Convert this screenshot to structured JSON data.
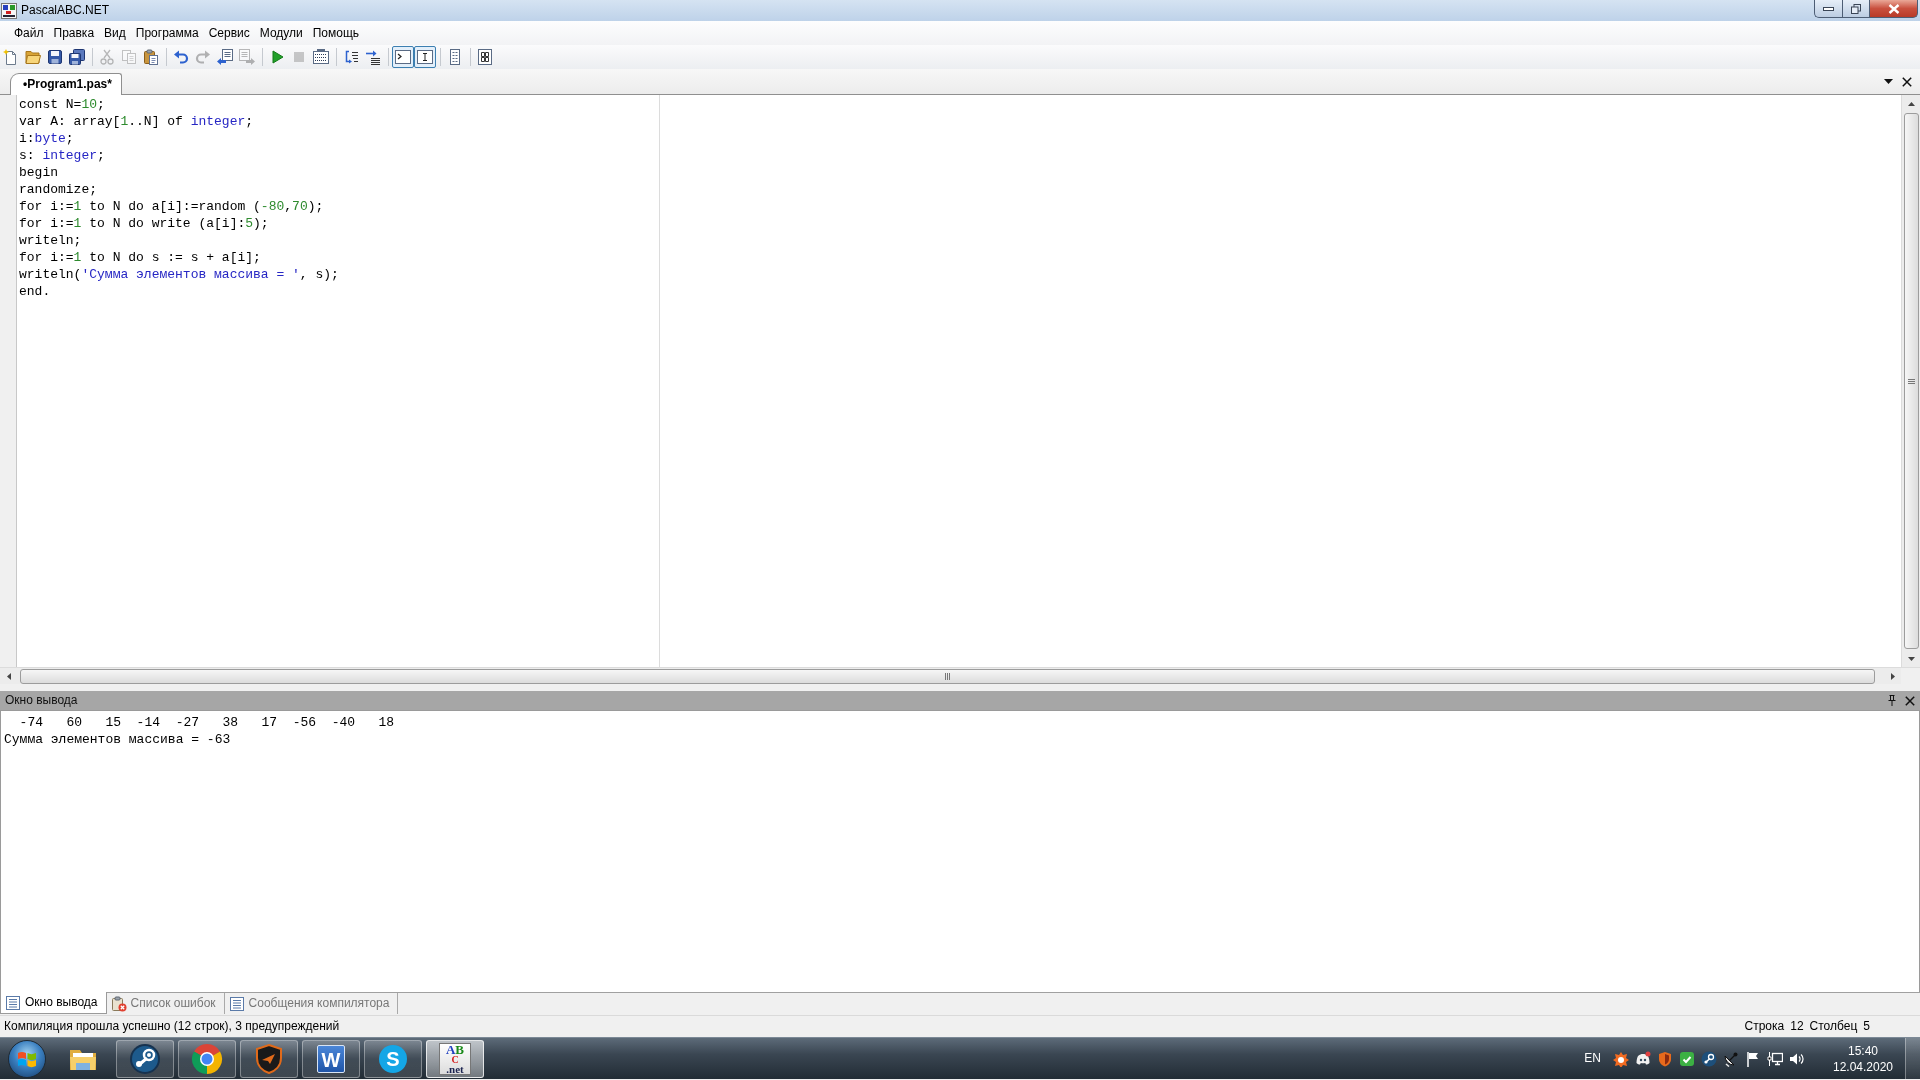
{
  "window": {
    "title": "PascalABC.NET"
  },
  "menu": [
    "Файл",
    "Правка",
    "Вид",
    "Программа",
    "Сервис",
    "Модули",
    "Помощь"
  ],
  "toolbar": [
    {
      "buttons": [
        {
          "disabled": false,
          "pressed": false
        },
        {
          "disabled": false,
          "pressed": false
        },
        {
          "disabled": false,
          "pressed": false
        },
        {
          "disabled": false,
          "pressed": false
        }
      ]
    },
    {
      "buttons": [
        {
          "disabled": true,
          "pressed": false
        },
        {
          "disabled": true,
          "pressed": false
        },
        {
          "disabled": false,
          "pressed": false
        }
      ]
    },
    {
      "buttons": [
        {
          "disabled": false,
          "pressed": false
        },
        {
          "disabled": true,
          "pressed": false
        },
        {
          "disabled": false,
          "pressed": false
        },
        {
          "disabled": true,
          "pressed": false
        }
      ]
    },
    {
      "buttons": [
        {
          "disabled": false,
          "pressed": false
        },
        {
          "disabled": true,
          "pressed": false
        },
        {
          "disabled": false,
          "pressed": false
        }
      ]
    },
    {
      "buttons": [
        {
          "disabled": false,
          "pressed": false
        },
        {
          "disabled": false,
          "pressed": false
        }
      ]
    },
    {
      "buttons": [
        {
          "disabled": false,
          "pressed": true
        },
        {
          "disabled": false,
          "pressed": true
        }
      ]
    },
    {
      "buttons": [
        {
          "disabled": false,
          "pressed": false
        }
      ]
    },
    {
      "buttons": [
        {
          "disabled": false,
          "pressed": false
        }
      ]
    }
  ],
  "editor_tabs": [
    {
      "label": "•Program1.pas*",
      "selected": true
    }
  ],
  "editor": {
    "lines": [
      [
        {
          "text": "const N=",
          "kind": "plain"
        },
        {
          "text": "10",
          "kind": "number"
        },
        {
          "text": ";",
          "kind": "plain"
        }
      ],
      [
        {
          "text": "var A: array[",
          "kind": "plain"
        },
        {
          "text": "1",
          "kind": "number"
        },
        {
          "text": "..N] of ",
          "kind": "plain"
        },
        {
          "text": "integer",
          "kind": "type"
        },
        {
          "text": ";",
          "kind": "plain"
        }
      ],
      [
        {
          "text": "i:",
          "kind": "plain"
        },
        {
          "text": "byte",
          "kind": "type"
        },
        {
          "text": ";",
          "kind": "plain"
        }
      ],
      [
        {
          "text": "s: ",
          "kind": "plain"
        },
        {
          "text": "integer",
          "kind": "type"
        },
        {
          "text": ";",
          "kind": "plain"
        }
      ],
      [
        {
          "text": "begin",
          "kind": "plain"
        }
      ],
      [
        {
          "text": "randomize;",
          "kind": "plain"
        }
      ],
      [
        {
          "text": "for i:=",
          "kind": "plain"
        },
        {
          "text": "1",
          "kind": "number"
        },
        {
          "text": " to N do a[i]:=random (",
          "kind": "plain"
        },
        {
          "text": "-80",
          "kind": "number"
        },
        {
          "text": ",",
          "kind": "plain"
        },
        {
          "text": "70",
          "kind": "number"
        },
        {
          "text": ");",
          "kind": "plain"
        }
      ],
      [
        {
          "text": "for i:=",
          "kind": "plain"
        },
        {
          "text": "1",
          "kind": "number"
        },
        {
          "text": " to N do write (a[i]:",
          "kind": "plain"
        },
        {
          "text": "5",
          "kind": "number"
        },
        {
          "text": ");",
          "kind": "plain"
        }
      ],
      [
        {
          "text": "writeln;",
          "kind": "plain"
        }
      ],
      [
        {
          "text": "for i:=",
          "kind": "plain"
        },
        {
          "text": "1",
          "kind": "number"
        },
        {
          "text": " to N do s := s + a[i];",
          "kind": "plain"
        }
      ],
      [
        {
          "text": "writeln(",
          "kind": "plain"
        },
        {
          "text": "'Сумма элементов массива = '",
          "kind": "string"
        },
        {
          "text": ", s);",
          "kind": "plain"
        }
      ],
      [
        {
          "text": "end.",
          "kind": "plain"
        }
      ]
    ]
  },
  "output_panel": {
    "title": "Окно вывода",
    "lines": [
      "  -74   60   15  -14  -27   38   17  -56  -40   18",
      "Сумма элементов массива = -63"
    ]
  },
  "bottom_tabs": [
    {
      "label": "Окно вывода",
      "selected": true
    },
    {
      "label": "Список ошибок",
      "selected": false
    },
    {
      "label": "Сообщения компилятора",
      "selected": false
    }
  ],
  "status_bar": {
    "message": "Компиляция прошла успешно (12 строк), 3 предупреждений",
    "position": [
      {
        "label": "Строка",
        "value": "12"
      },
      {
        "label": "Столбец",
        "value": "5"
      }
    ]
  },
  "taskbar": {
    "apps": [
      {
        "running": false,
        "active": false
      },
      {
        "running": true,
        "active": false
      },
      {
        "running": true,
        "active": false
      },
      {
        "running": true,
        "active": false
      },
      {
        "running": true,
        "active": false,
        "glyph": [
          "W"
        ]
      },
      {
        "running": true,
        "active": false,
        "glyph": [
          "S"
        ]
      },
      {
        "running": true,
        "active": true,
        "glyph": [
          "AB",
          "C",
          ".net"
        ]
      }
    ],
    "language": "EN",
    "time": "15:40",
    "date": "12.04.2020"
  }
}
